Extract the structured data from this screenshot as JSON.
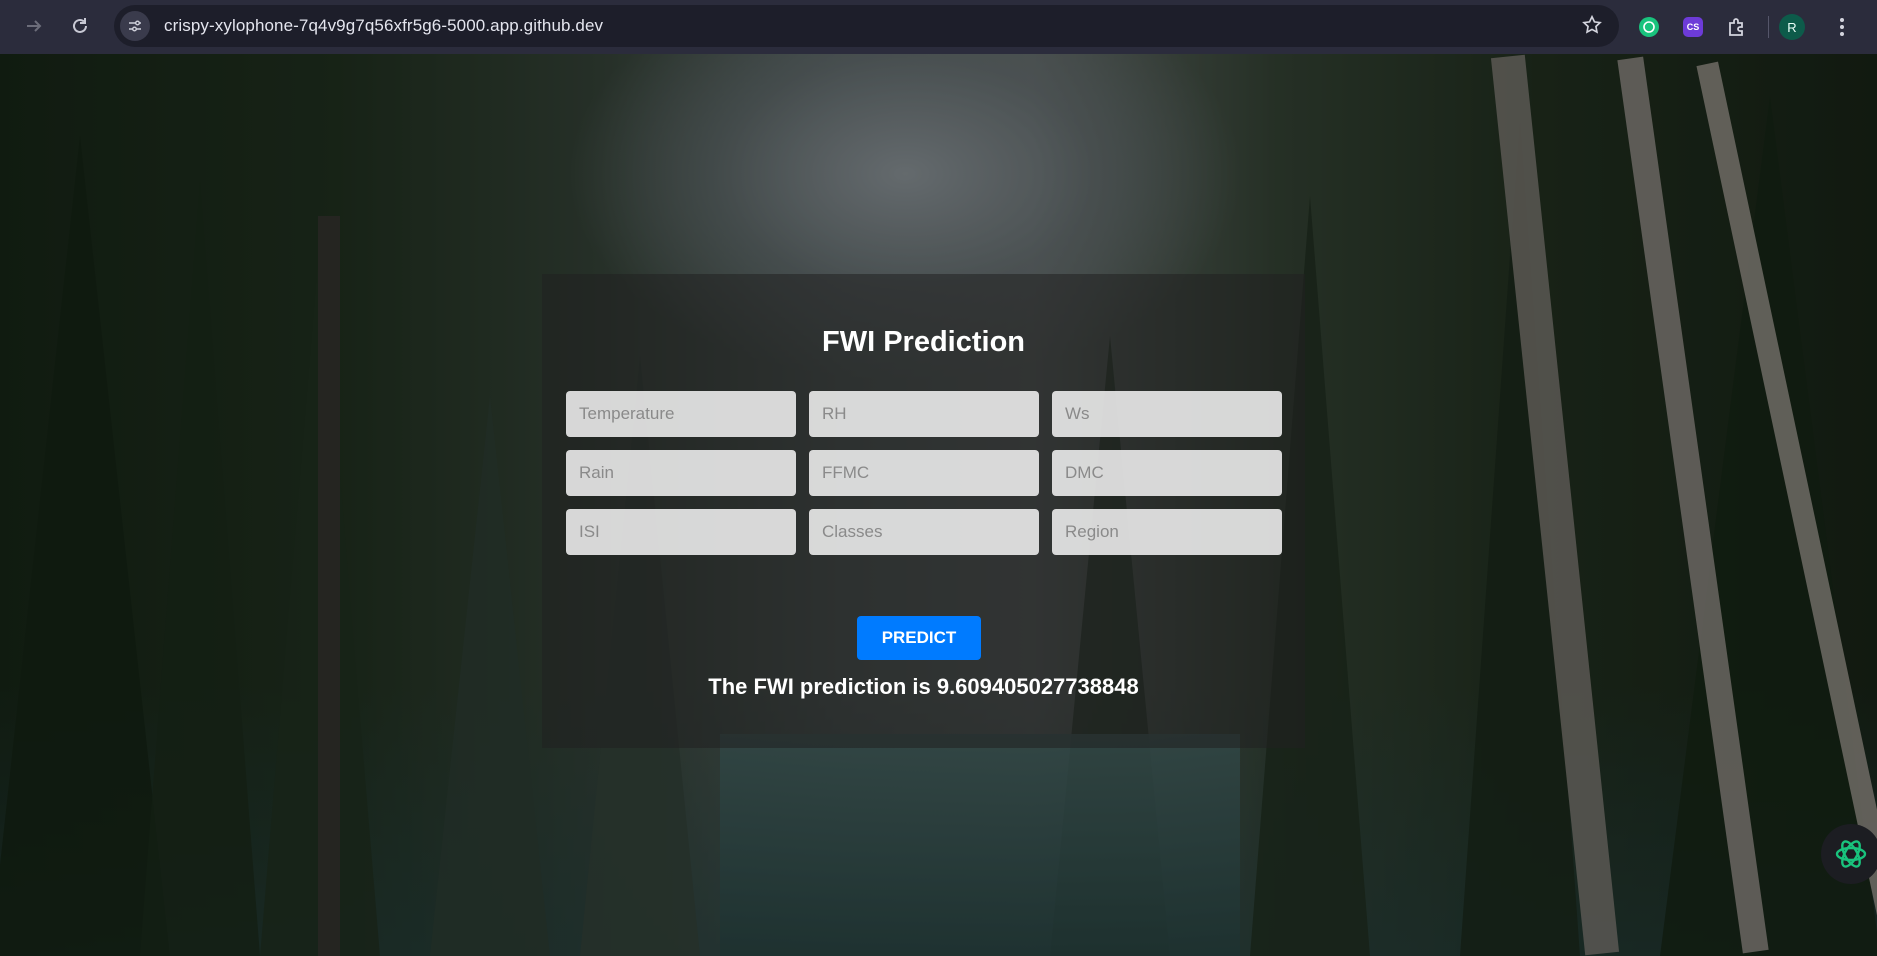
{
  "browser": {
    "url": "crispy-xylophone-7q4v9g7q56xfr5g6-5000.app.github.dev",
    "avatar_initial": "R",
    "extensions": [
      "chatgpt-icon",
      "cs-extension-icon",
      "puzzle-icon"
    ],
    "cs_label": "CS"
  },
  "page": {
    "title": "FWI Prediction",
    "fields": [
      {
        "placeholder": "Temperature"
      },
      {
        "placeholder": "RH"
      },
      {
        "placeholder": "Ws"
      },
      {
        "placeholder": "Rain"
      },
      {
        "placeholder": "FFMC"
      },
      {
        "placeholder": "DMC"
      },
      {
        "placeholder": "ISI"
      },
      {
        "placeholder": "Classes"
      },
      {
        "placeholder": "Region"
      }
    ],
    "predict_label": "PREDICT",
    "result_text": "The FWI prediction is 9.609405027738848"
  },
  "colors": {
    "button": "#007bff",
    "chrome": "#2b2c3c",
    "omnibox": "#1d1e2a"
  }
}
